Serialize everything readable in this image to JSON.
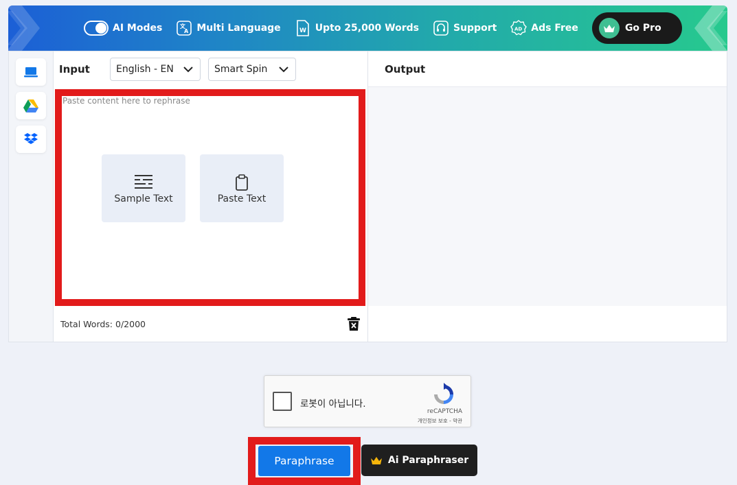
{
  "banner": {
    "items": [
      {
        "label": "AI Modes",
        "icon": "toggle-icon"
      },
      {
        "label": "Multi Language",
        "icon": "translate-icon"
      },
      {
        "label": "Upto 25,000 Words",
        "icon": "word-document-icon"
      },
      {
        "label": "Support",
        "icon": "headset-icon"
      },
      {
        "label": "Ads Free",
        "icon": "ad-badge-icon"
      }
    ],
    "go_pro": "Go Pro"
  },
  "sidebar": {
    "items": [
      "laptop-icon",
      "google-drive-icon",
      "dropbox-icon"
    ]
  },
  "input": {
    "title": "Input",
    "language": "English - EN",
    "mode": "Smart Spin",
    "placeholder": "Paste content here to rephrase",
    "sample_text": "Sample Text",
    "paste_text": "Paste Text",
    "word_count": "Total Words: 0/2000"
  },
  "output": {
    "title": "Output"
  },
  "captcha": {
    "label": "로봇이 아닙니다.",
    "brand": "reCAPTCHA",
    "links": "개인정보 보호 - 약관"
  },
  "actions": {
    "paraphrase": "Paraphrase",
    "ai_paraphraser": "Ai Paraphraser"
  },
  "colors": {
    "primary": "#1278e8",
    "highlight": "#e21b1b",
    "dark": "#1f1f1f",
    "pro_badge": "#3fbf92"
  }
}
